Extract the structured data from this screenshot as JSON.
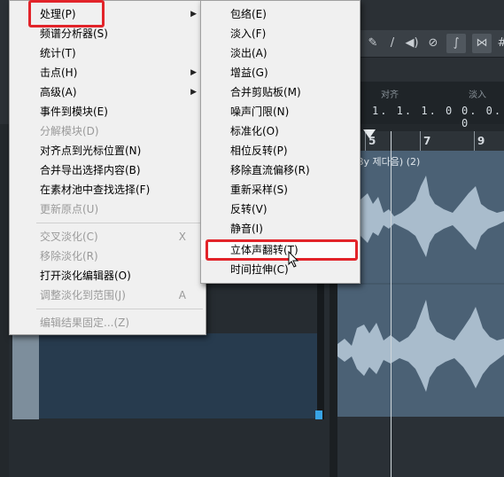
{
  "menu_main": {
    "items": [
      {
        "label": "处理(P)",
        "submenu": true
      },
      {
        "label": "频谱分析器(S)"
      },
      {
        "label": "统计(T)"
      },
      {
        "label": "击点(H)",
        "submenu": true
      },
      {
        "label": "高级(A)",
        "submenu": true
      },
      {
        "label": "事件到模块(E)"
      },
      {
        "label": "分解模块(D)",
        "disabled": true
      },
      {
        "label": "对齐点到光标位置(N)"
      },
      {
        "label": "合并导出选择内容(B)"
      },
      {
        "label": "在素材池中查找选择(F)"
      },
      {
        "label": "更新原点(U)",
        "disabled": true
      },
      {
        "label": "交叉淡化(C)",
        "shortcut": "X",
        "disabled": true
      },
      {
        "label": "移除淡化(R)",
        "disabled": true
      },
      {
        "label": "打开淡化编辑器(O)"
      },
      {
        "label": "调整淡化到范围(J)",
        "shortcut": "A",
        "disabled": true
      },
      {
        "label": "编辑结果固定...(Z)",
        "disabled": true
      }
    ]
  },
  "menu_process": {
    "items": [
      {
        "label": "包络(E)"
      },
      {
        "label": "淡入(F)"
      },
      {
        "label": "淡出(A)"
      },
      {
        "label": "增益(G)"
      },
      {
        "label": "合并剪贴板(M)"
      },
      {
        "label": "噪声门限(N)"
      },
      {
        "label": "标准化(O)"
      },
      {
        "label": "相位反转(P)"
      },
      {
        "label": "移除直流偏移(R)"
      },
      {
        "label": "重新采样(S)"
      },
      {
        "label": "反转(V)"
      },
      {
        "label": "静音(I)"
      },
      {
        "label": "立体声翻转(T)"
      },
      {
        "label": "时间拉伸(C)"
      }
    ]
  },
  "toolbar": {
    "icons": [
      "pencil-icon",
      "line-icon",
      "speaker-icon",
      "mute-icon",
      "snap-icon",
      "quantize-icon",
      "grid-icon"
    ]
  },
  "info_line": {
    "align_label": "对齐",
    "align_value": "1. 1. 1.  0",
    "fadein_label": "淡入",
    "fadein_value": "0. 0. 0"
  },
  "ruler": {
    "ticks": [
      "5",
      "7",
      "9"
    ]
  },
  "event": {
    "title": "By 제다음) (2)"
  },
  "colors": {
    "highlight_box": "#e2242a",
    "menu_bg": "#f0f0f0",
    "waveform": "#a9bccc",
    "event_bg": "#4b6175"
  }
}
